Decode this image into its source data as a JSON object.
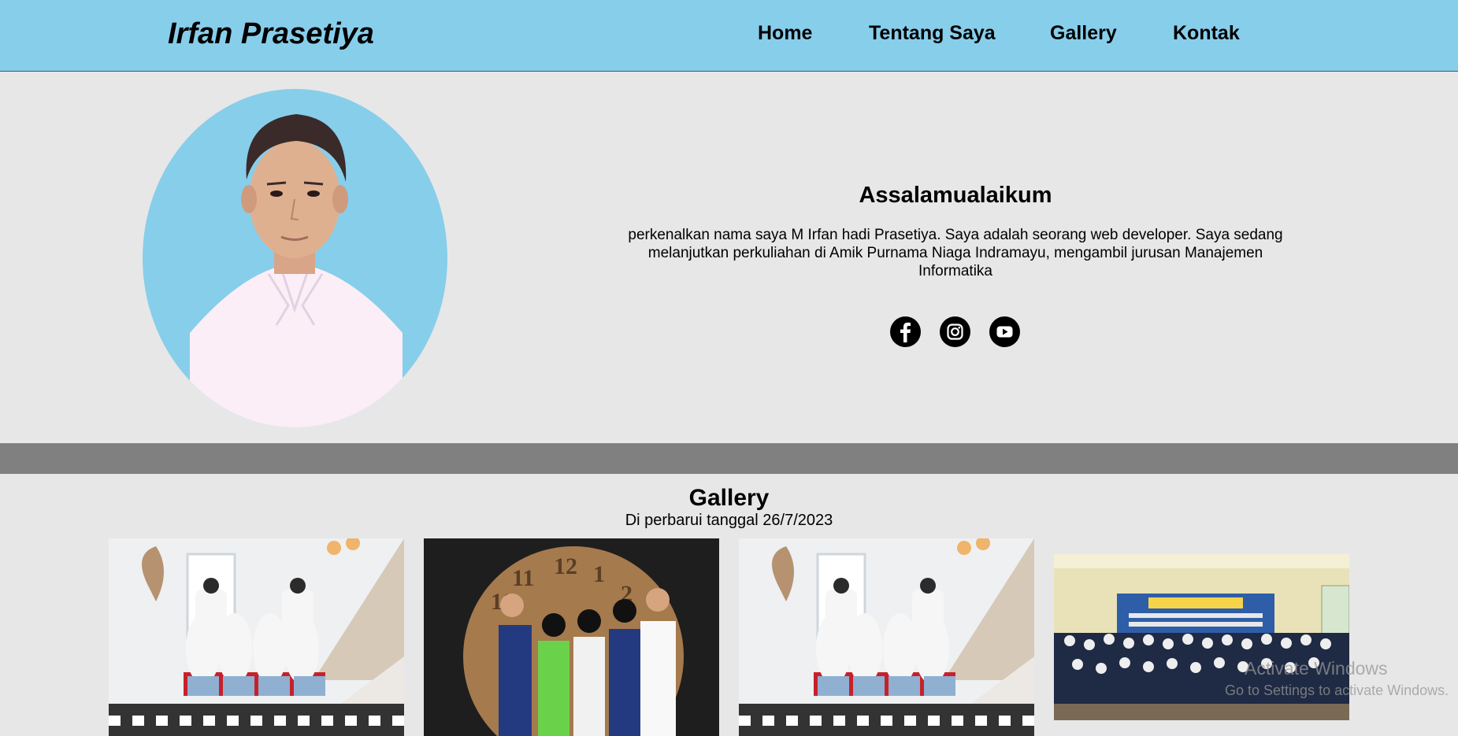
{
  "header": {
    "brand": "Irfan Prasetiya",
    "nav": [
      "Home",
      "Tentang Saya",
      "Gallery",
      "Kontak"
    ]
  },
  "hero": {
    "title": "Assalamualaikum",
    "description": "perkenalkan nama saya M Irfan hadi Prasetiya. Saya adalah seorang web developer. Saya sedang melanjutkan perkuliahan di Amik Purnama Niaga Indramayu, mengambil jurusan Manajemen Informatika",
    "socials": [
      "facebook-icon",
      "instagram-icon",
      "youtube-icon"
    ]
  },
  "gallery": {
    "title": "Gallery",
    "subtitle": "Di perbarui tanggal 26/7/2023"
  },
  "os_overlay": {
    "line1": "Activate Windows",
    "line2": "Go to Settings to activate Windows."
  },
  "colors": {
    "header_bg": "#87ceeb",
    "page_bg": "#e7e7e7",
    "divider": "#808080"
  }
}
